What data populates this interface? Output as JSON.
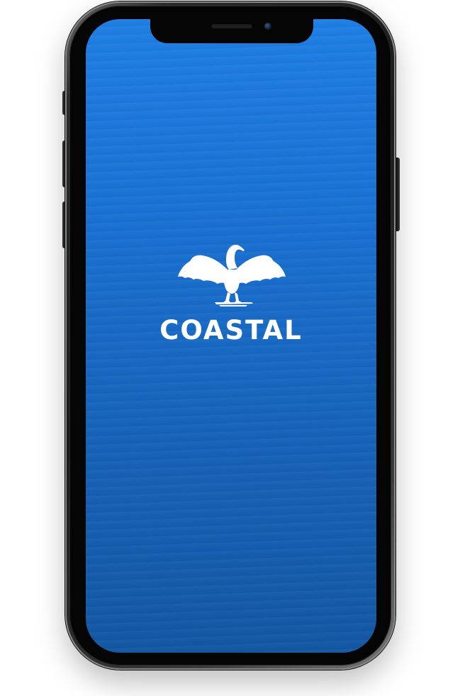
{
  "app": {
    "brand_name": "COASTAL",
    "logo_icon": "cormorant-bird-icon"
  },
  "colors": {
    "screen_top": "#1f7fe4",
    "screen_bottom": "#1358a3",
    "logo": "#ffffff",
    "device_frame": "#1a1a1a"
  }
}
